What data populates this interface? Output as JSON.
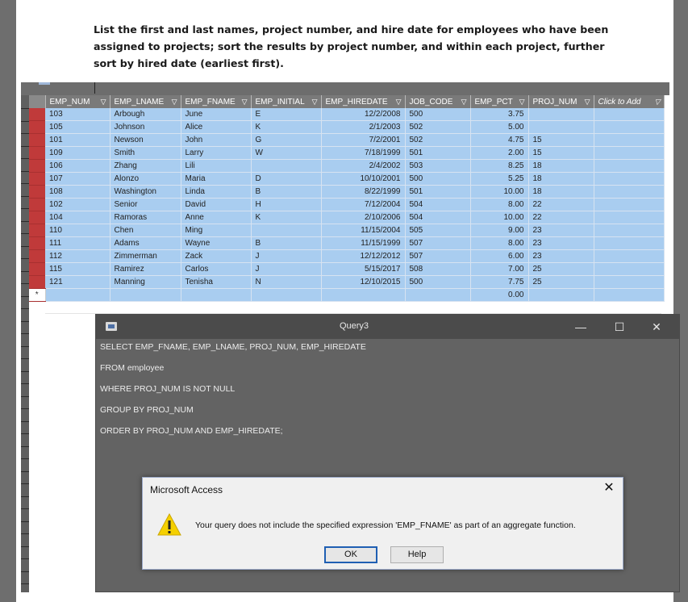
{
  "instructions": "List the first and last names, project number, and hire date for employees who have been assigned to projects; sort the results by project number, and within each project, further sort by hired date (earliest first).",
  "table": {
    "columns": [
      "EMP_NUM",
      "EMP_LNAME",
      "EMP_FNAME",
      "EMP_INITIAL",
      "EMP_HIREDATE",
      "JOB_CODE",
      "EMP_PCT",
      "PROJ_NUM",
      "Click to Add"
    ],
    "rows": [
      [
        "103",
        "Arbough",
        "June",
        "E",
        "12/2/2008",
        "500",
        "3.75",
        ""
      ],
      [
        "105",
        "Johnson",
        "Alice",
        "K",
        "2/1/2003",
        "502",
        "5.00",
        ""
      ],
      [
        "101",
        "Newson",
        "John",
        "G",
        "7/2/2001",
        "502",
        "4.75",
        "15"
      ],
      [
        "109",
        "Smith",
        "Larry",
        "W",
        "7/18/1999",
        "501",
        "2.00",
        "15"
      ],
      [
        "106",
        "Zhang",
        "Lili",
        "",
        "2/4/2002",
        "503",
        "8.25",
        "18"
      ],
      [
        "107",
        "Alonzo",
        "Maria",
        "D",
        "10/10/2001",
        "500",
        "5.25",
        "18"
      ],
      [
        "108",
        "Washington",
        "Linda",
        "B",
        "8/22/1999",
        "501",
        "10.00",
        "18"
      ],
      [
        "102",
        "Senior",
        "David",
        "H",
        "7/12/2004",
        "504",
        "8.00",
        "22"
      ],
      [
        "104",
        "Ramoras",
        "Anne",
        "K",
        "2/10/2006",
        "504",
        "10.00",
        "22"
      ],
      [
        "110",
        "Chen",
        "Ming",
        "",
        "11/15/2004",
        "505",
        "9.00",
        "23"
      ],
      [
        "111",
        "Adams",
        "Wayne",
        "B",
        "11/15/1999",
        "507",
        "8.00",
        "23"
      ],
      [
        "112",
        "Zimmerman",
        "Zack",
        "J",
        "12/12/2012",
        "507",
        "6.00",
        "23"
      ],
      [
        "115",
        "Ramirez",
        "Carlos",
        "J",
        "5/15/2017",
        "508",
        "7.00",
        "25"
      ],
      [
        "121",
        "Manning",
        "Tenisha",
        "N",
        "12/10/2015",
        "500",
        "7.75",
        "25"
      ]
    ],
    "new_row_marker": "*",
    "new_row_pct": "0.00"
  },
  "query_window": {
    "title": "Query3",
    "minimize": "—",
    "maximize": "☐",
    "close": "✕",
    "sql": [
      "SELECT EMP_FNAME, EMP_LNAME, PROJ_NUM, EMP_HIREDATE",
      "FROM employee",
      "WHERE PROJ_NUM IS NOT NULL",
      "GROUP BY PROJ_NUM",
      "ORDER BY PROJ_NUM AND EMP_HIREDATE;"
    ]
  },
  "dialog": {
    "title": "Microsoft Access",
    "close": "✕",
    "message": "Your query does not include the specified expression 'EMP_FNAME' as part of an aggregate function.",
    "ok_label": "OK",
    "help_label": "Help",
    "icon": "warning-icon"
  }
}
